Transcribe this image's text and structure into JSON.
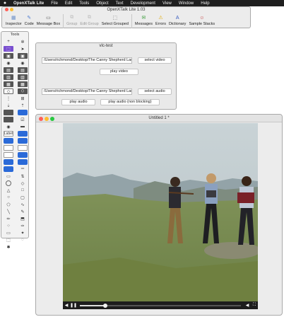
{
  "menubar": {
    "apple": "",
    "items": [
      "OpenXTalk Lite",
      "File",
      "Edit",
      "Tools",
      "Object",
      "Text",
      "Development",
      "View",
      "Window",
      "Help"
    ]
  },
  "toolbar": {
    "title": "OpenXTalk Lite 1.03",
    "buttons": [
      {
        "label": "Inspector",
        "icon": "inspector-icon",
        "glyph": "▦",
        "color": "#6a8fc9",
        "enabled": true
      },
      {
        "label": "Code",
        "icon": "code-icon",
        "glyph": "✎",
        "color": "#4c7bd0",
        "enabled": true
      },
      {
        "label": "Message Box",
        "icon": "message-box-icon",
        "glyph": "▭",
        "color": "#555555",
        "enabled": true
      },
      {
        "label": "Group",
        "icon": "group-icon",
        "glyph": "⧉",
        "color": "#888888",
        "enabled": false
      },
      {
        "label": "Edit Group",
        "icon": "edit-group-icon",
        "glyph": "⧉",
        "color": "#888888",
        "enabled": false
      },
      {
        "label": "Select Grouped",
        "icon": "select-grouped-icon",
        "glyph": "⬚",
        "color": "#666666",
        "enabled": true
      },
      {
        "label": "Messages",
        "icon": "messages-icon",
        "glyph": "✉",
        "color": "#3e9e3e",
        "enabled": true
      },
      {
        "label": "Errors",
        "icon": "errors-icon",
        "glyph": "⚠",
        "color": "#e0a800",
        "enabled": true
      },
      {
        "label": "Dictionary",
        "icon": "dictionary-icon",
        "glyph": "A",
        "color": "#3a5ec0",
        "enabled": true
      },
      {
        "label": "Sample Stacks",
        "icon": "sample-stacks-icon",
        "glyph": "☺",
        "color": "#c43a3a",
        "enabled": true
      }
    ]
  },
  "tools": {
    "title": "Tools"
  },
  "vlc": {
    "title": "vlc-test",
    "video_path": "/Users/richmond/Desktop/The Canny Shepherd Laddie",
    "select_video": "select video",
    "play_video": "play video",
    "audio_path": "/Users/richmond/Desktop/The Canny Shepherd Laddie",
    "select_audio": "select audio",
    "play_audio": "play audio",
    "play_audio_nb": "play audio (non blocking)"
  },
  "player": {
    "title": "Untitled 1 *",
    "progress": 0.16,
    "play_glyph": "◀",
    "pause_glyph": "❚❚",
    "volume_glyph": "◀",
    "fullscreen_glyph": "⛶"
  },
  "colors": {
    "menubar": "#1f1f1f",
    "close": "#ff5f57",
    "minimize": "#febc2e",
    "zoom": "#28c840"
  }
}
